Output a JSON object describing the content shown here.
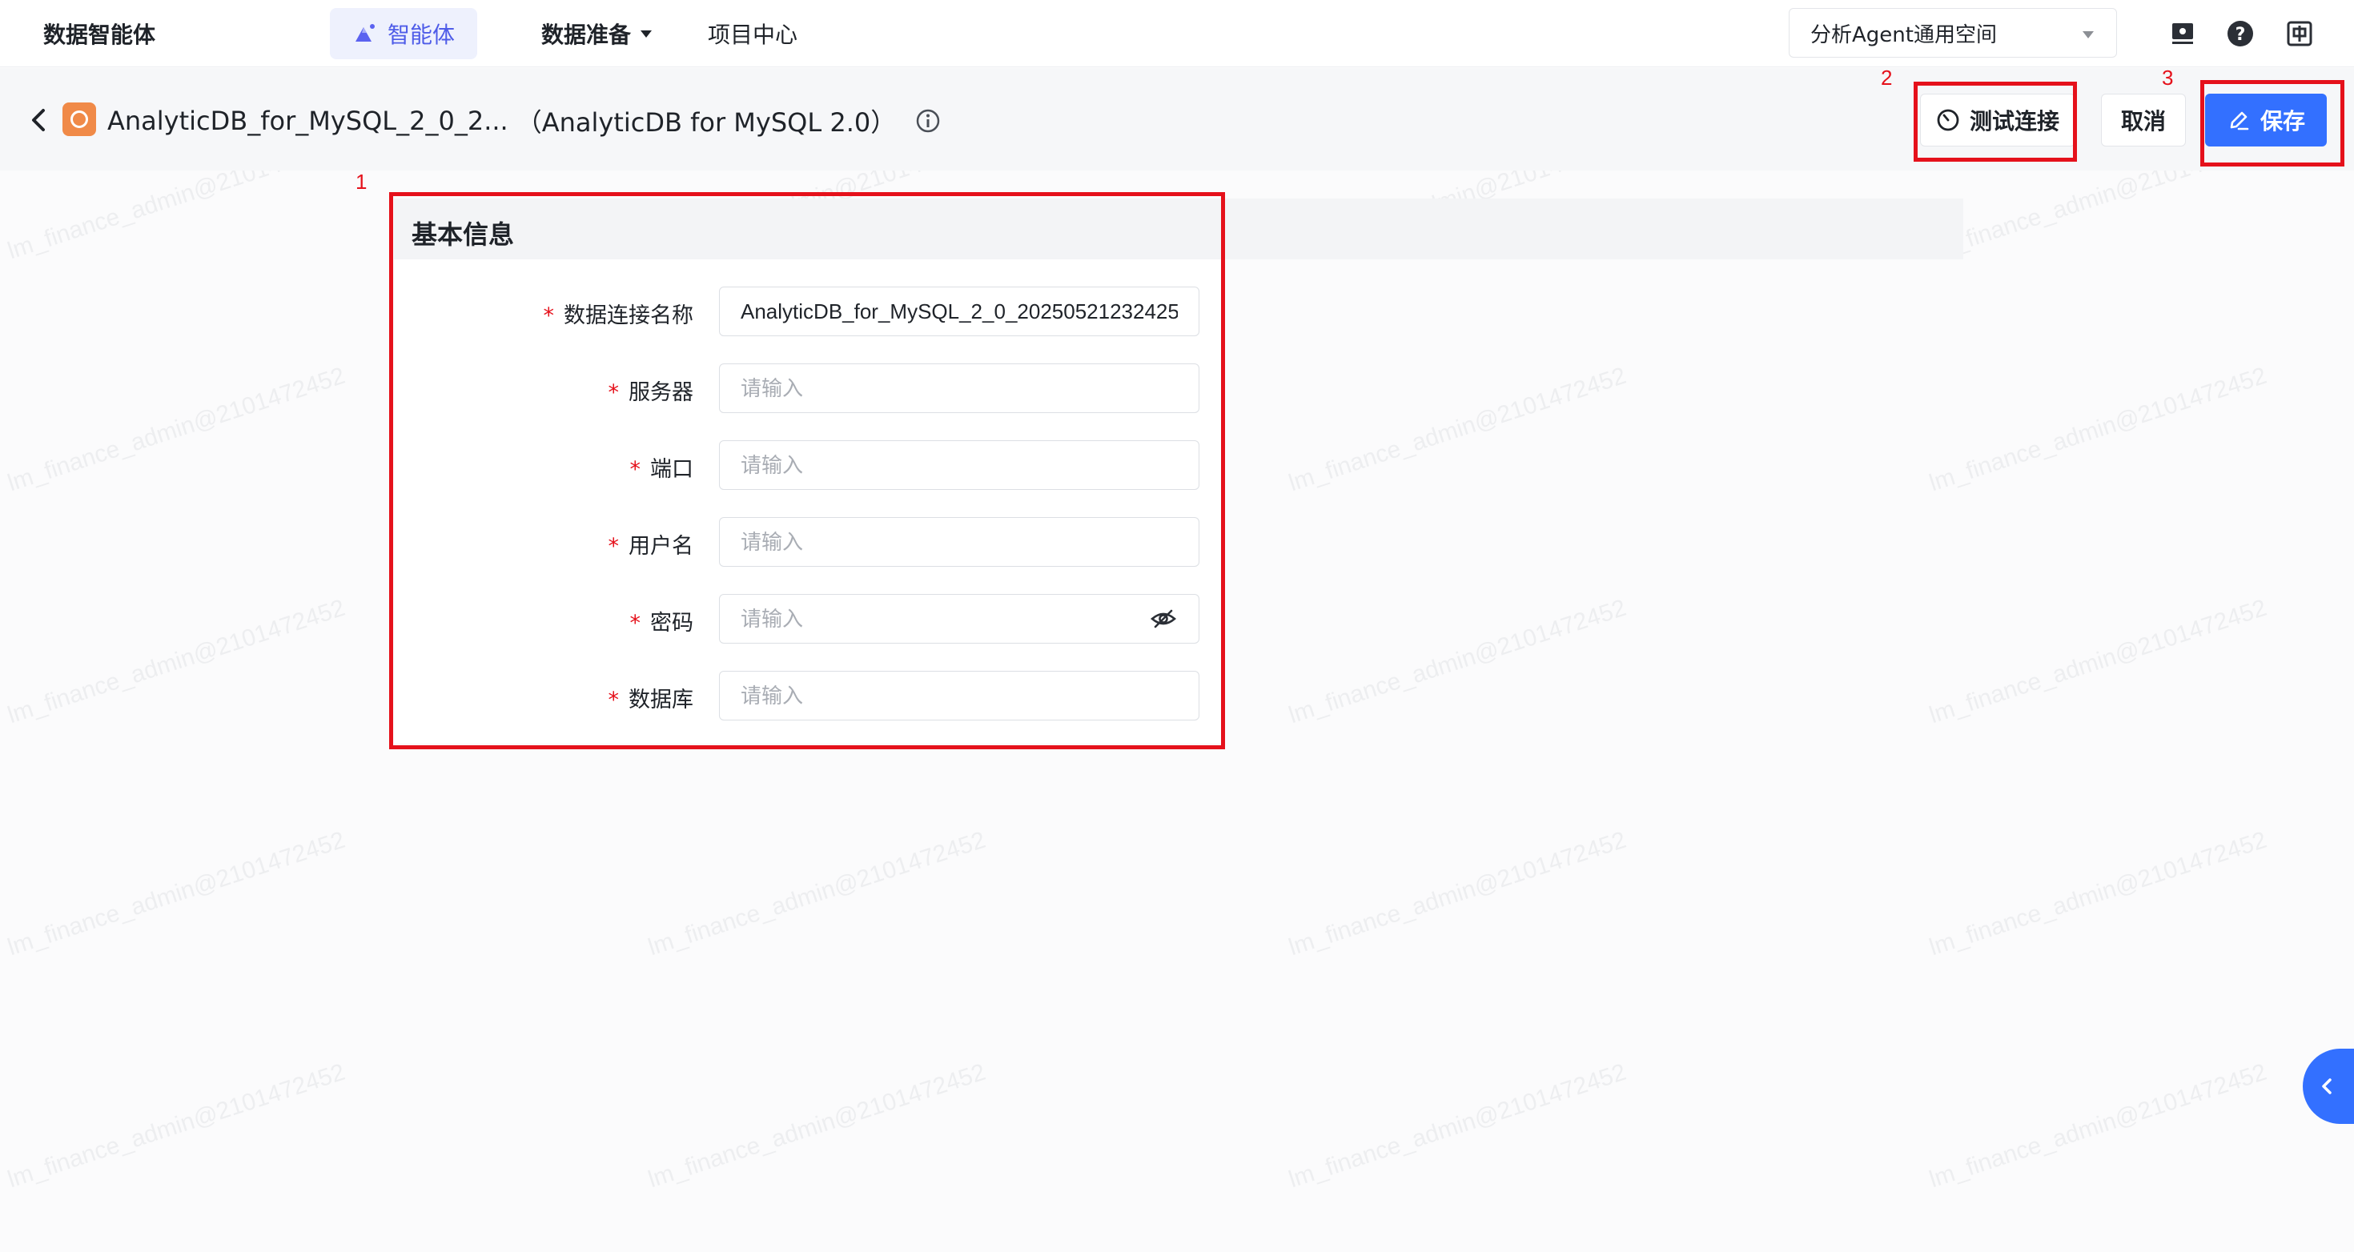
{
  "topnav": {
    "brand": "数据智能体",
    "agent_tab": "智能体",
    "data_prep": "数据准备",
    "project_center": "项目中心",
    "workspace": "分析Agent通用空间",
    "icons": [
      "screen-share-icon",
      "help-icon",
      "language-icon"
    ]
  },
  "header": {
    "connection_name": "AnalyticDB_for_MySQL_2_0_2...",
    "connection_type": "（AnalyticDB for MySQL 2.0）",
    "test_button": "测试连接",
    "cancel_button": "取消",
    "save_button": "保存"
  },
  "annotations": [
    "1",
    "2",
    "3"
  ],
  "form": {
    "section_title": "基本信息",
    "fields": [
      {
        "label": "数据连接名称",
        "value": "AnalyticDB_for_MySQL_2_0_20250521232425",
        "placeholder": "请输入",
        "required": "*"
      },
      {
        "label": "服务器",
        "value": "",
        "placeholder": "请输入",
        "required": "*"
      },
      {
        "label": "端口",
        "value": "",
        "placeholder": "请输入",
        "required": "*"
      },
      {
        "label": "用户名",
        "value": "",
        "placeholder": "请输入",
        "required": "*"
      },
      {
        "label": "密码",
        "value": "",
        "placeholder": "请输入",
        "required": "*"
      },
      {
        "label": "数据库",
        "value": "",
        "placeholder": "请输入",
        "required": "*"
      }
    ]
  },
  "watermark": "lm_finance_admin@2101472452",
  "colors": {
    "primary": "#3370ff",
    "annotation": "#e5111b",
    "agent_accent": "#4e5ce8"
  }
}
